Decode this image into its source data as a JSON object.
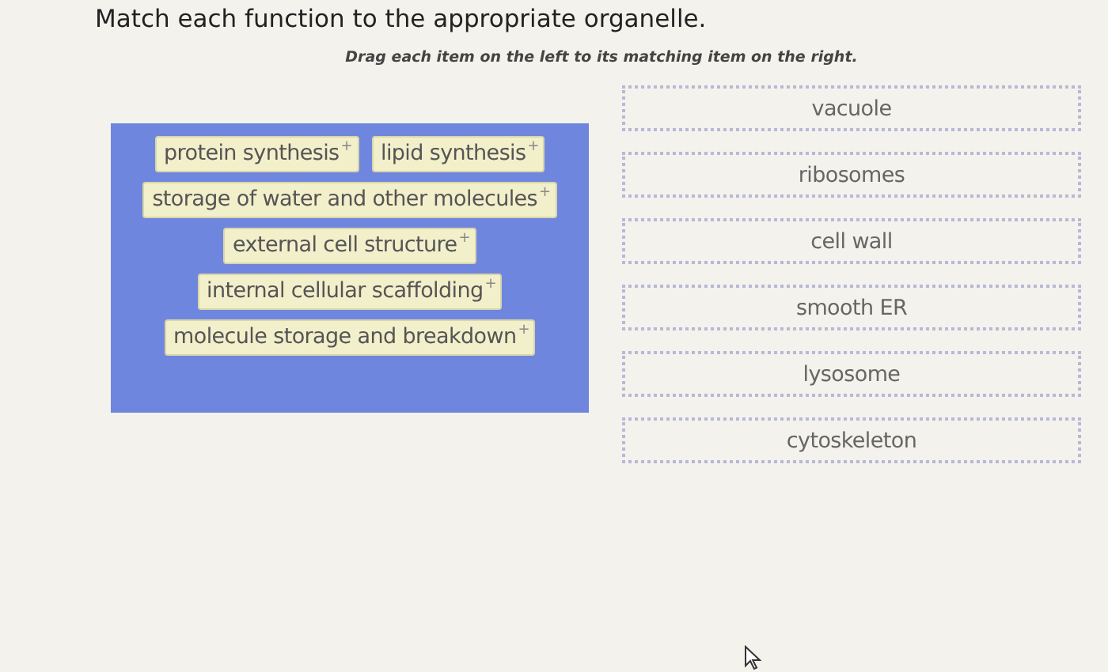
{
  "title": "Match each function to the appropriate organelle.",
  "instructions": "Drag each item on the left to its matching item on the right.",
  "items": [
    {
      "rows": [
        {
          "label": "protein synthesis",
          "marker": "+"
        },
        {
          "label": "lipid synthesis",
          "marker": "+"
        }
      ]
    },
    {
      "rows": [
        {
          "label": "storage of water and other molecules",
          "marker": "+"
        }
      ]
    },
    {
      "rows": [
        {
          "label": "external cell structure",
          "marker": "+"
        }
      ]
    },
    {
      "rows": [
        {
          "label": "internal cellular scaffolding",
          "marker": "+"
        }
      ]
    },
    {
      "rows": [
        {
          "label": "molecule storage and breakdown",
          "marker": "+"
        }
      ]
    }
  ],
  "targets": [
    "vacuole",
    "ribosomes",
    "cell wall",
    "smooth ER",
    "lysosome",
    "cytoskeleton"
  ]
}
